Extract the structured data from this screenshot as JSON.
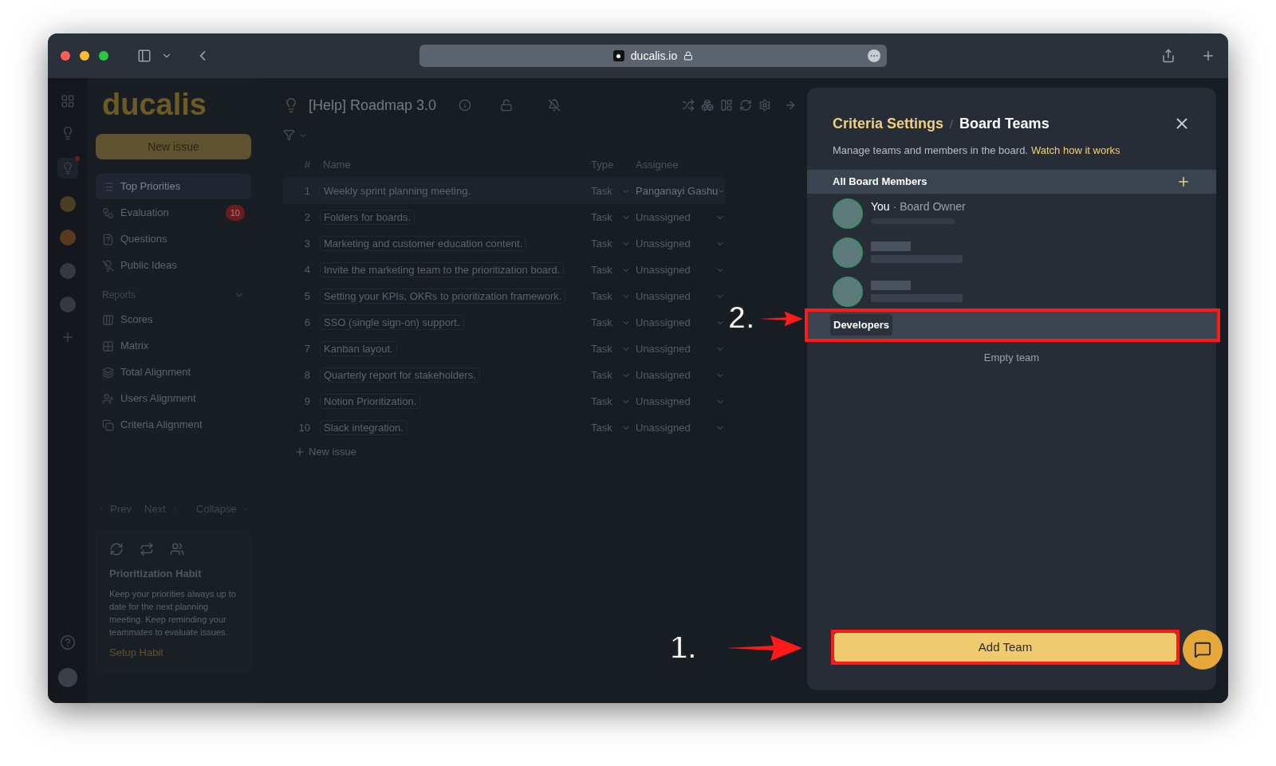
{
  "browser": {
    "address": "ducalis.io"
  },
  "sidebar": {
    "logo": "ducalis",
    "new_issue": "New issue",
    "items": [
      {
        "label": "Top Priorities",
        "selected": true
      },
      {
        "label": "Evaluation",
        "selected": false,
        "badge": "10"
      },
      {
        "label": "Questions",
        "selected": false
      },
      {
        "label": "Public Ideas",
        "selected": false
      }
    ],
    "reports_heading": "Reports",
    "reports": [
      {
        "label": "Scores",
        "selected": false
      },
      {
        "label": "Matrix",
        "selected": false
      },
      {
        "label": "Total Alignment",
        "selected": false
      },
      {
        "label": "Users Alignment",
        "selected": false
      },
      {
        "label": "Criteria Alignment",
        "selected": false
      }
    ],
    "pager": {
      "prev": "Prev",
      "next": "Next",
      "collapse": "Collapse"
    },
    "habit": {
      "title": "Prioritization Habit",
      "text": "Keep your priorities always up to date for the next planning meeting. Keep reminding your teammates to evaluate issues.",
      "link": "Setup Habit"
    }
  },
  "board": {
    "title": "[Help] Roadmap 3.0",
    "columns": [
      "#",
      "Name",
      "Type",
      "Assignee"
    ],
    "rows": [
      {
        "num": "1",
        "name": "Weekly sprint planning meeting.",
        "type": "Task",
        "assignee": "Panganayi Gashu",
        "selected": true
      },
      {
        "num": "2",
        "name": "Folders for boards.",
        "type": "Task",
        "assignee": "Unassigned",
        "selected": false
      },
      {
        "num": "3",
        "name": "Marketing and customer education content.",
        "type": "Task",
        "assignee": "Unassigned",
        "selected": false
      },
      {
        "num": "4",
        "name": "Invite the marketing team to the prioritization board.",
        "type": "Task",
        "assignee": "Unassigned",
        "selected": false
      },
      {
        "num": "5",
        "name": "Setting your KPIs, OKRs to prioritization framework.",
        "type": "Task",
        "assignee": "Unassigned",
        "selected": false
      },
      {
        "num": "6",
        "name": "SSO (single sign-on) support.",
        "type": "Task",
        "assignee": "Unassigned",
        "selected": false
      },
      {
        "num": "7",
        "name": "Kanban layout.",
        "type": "Task",
        "assignee": "Unassigned",
        "selected": false
      },
      {
        "num": "8",
        "name": "Quarterly report for stakeholders.",
        "type": "Task",
        "assignee": "Unassigned",
        "selected": false
      },
      {
        "num": "9",
        "name": "Notion Prioritization.",
        "type": "Task",
        "assignee": "Unassigned",
        "selected": false
      },
      {
        "num": "10",
        "name": "Slack integration.",
        "type": "Task",
        "assignee": "Unassigned",
        "selected": false
      }
    ],
    "new_issue": "New issue"
  },
  "panel": {
    "parent": "Criteria Settings",
    "separator": "/",
    "title": "Board Teams",
    "description": "Manage teams and members in the board.",
    "link": "Watch how it works",
    "members_heading": "All Board Members",
    "members": [
      {
        "kind": "named",
        "name": "You",
        "role": "· Board Owner"
      },
      {
        "kind": "blurred"
      },
      {
        "kind": "blurred"
      }
    ],
    "team": {
      "name": "Developers",
      "empty_text": "Empty team"
    },
    "add_team": "Add Team"
  },
  "annotations": [
    {
      "label": "2."
    },
    {
      "label": "1."
    }
  ]
}
